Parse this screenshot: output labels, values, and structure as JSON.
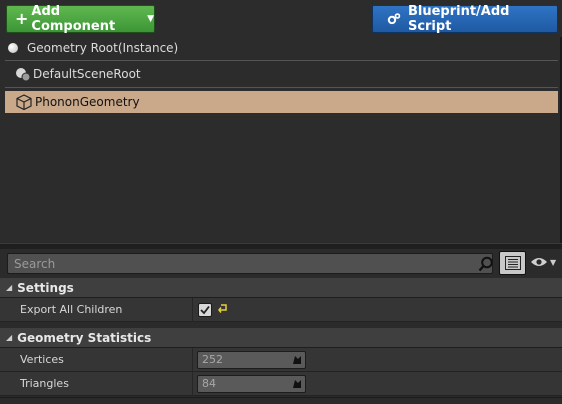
{
  "toolbar": {
    "add_component_label": "Add Component",
    "blueprint_label": "Blueprint/Add Script"
  },
  "component_tree": {
    "root_label": "Geometry Root(Instance)",
    "items": [
      {
        "label": "DefaultSceneRoot",
        "icon": "scene-root-icon"
      },
      {
        "label": "PhononGeometry",
        "icon": "cube-icon",
        "selected": true
      }
    ],
    "selection_color": "#c9a98a"
  },
  "details": {
    "search": {
      "placeholder": "Search",
      "value": ""
    },
    "categories": [
      {
        "label": "Settings",
        "properties": [
          {
            "label": "Export All Children",
            "type": "checkbox",
            "checked": true
          }
        ]
      },
      {
        "label": "Geometry Statistics",
        "properties": [
          {
            "label": "Vertices",
            "type": "number",
            "value": "252"
          },
          {
            "label": "Triangles",
            "type": "number",
            "value": "84"
          }
        ]
      }
    ]
  },
  "colors": {
    "add_button": "#4fa843",
    "blueprint_button": "#2767b5",
    "panel_bg": "#2c2c2c"
  }
}
